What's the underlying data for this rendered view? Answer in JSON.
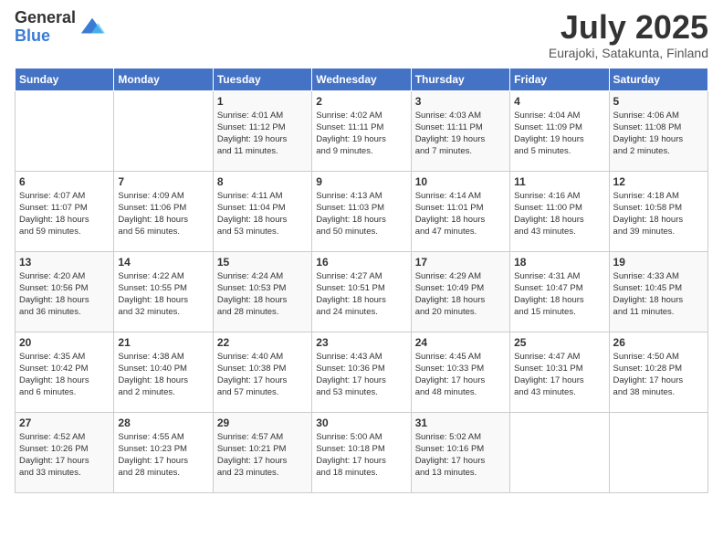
{
  "header": {
    "logo_general": "General",
    "logo_blue": "Blue",
    "month_title": "July 2025",
    "location": "Eurajoki, Satakunta, Finland"
  },
  "weekdays": [
    "Sunday",
    "Monday",
    "Tuesday",
    "Wednesday",
    "Thursday",
    "Friday",
    "Saturday"
  ],
  "weeks": [
    [
      {
        "day": "",
        "info": ""
      },
      {
        "day": "",
        "info": ""
      },
      {
        "day": "1",
        "info": "Sunrise: 4:01 AM\nSunset: 11:12 PM\nDaylight: 19 hours\nand 11 minutes."
      },
      {
        "day": "2",
        "info": "Sunrise: 4:02 AM\nSunset: 11:11 PM\nDaylight: 19 hours\nand 9 minutes."
      },
      {
        "day": "3",
        "info": "Sunrise: 4:03 AM\nSunset: 11:11 PM\nDaylight: 19 hours\nand 7 minutes."
      },
      {
        "day": "4",
        "info": "Sunrise: 4:04 AM\nSunset: 11:09 PM\nDaylight: 19 hours\nand 5 minutes."
      },
      {
        "day": "5",
        "info": "Sunrise: 4:06 AM\nSunset: 11:08 PM\nDaylight: 19 hours\nand 2 minutes."
      }
    ],
    [
      {
        "day": "6",
        "info": "Sunrise: 4:07 AM\nSunset: 11:07 PM\nDaylight: 18 hours\nand 59 minutes."
      },
      {
        "day": "7",
        "info": "Sunrise: 4:09 AM\nSunset: 11:06 PM\nDaylight: 18 hours\nand 56 minutes."
      },
      {
        "day": "8",
        "info": "Sunrise: 4:11 AM\nSunset: 11:04 PM\nDaylight: 18 hours\nand 53 minutes."
      },
      {
        "day": "9",
        "info": "Sunrise: 4:13 AM\nSunset: 11:03 PM\nDaylight: 18 hours\nand 50 minutes."
      },
      {
        "day": "10",
        "info": "Sunrise: 4:14 AM\nSunset: 11:01 PM\nDaylight: 18 hours\nand 47 minutes."
      },
      {
        "day": "11",
        "info": "Sunrise: 4:16 AM\nSunset: 11:00 PM\nDaylight: 18 hours\nand 43 minutes."
      },
      {
        "day": "12",
        "info": "Sunrise: 4:18 AM\nSunset: 10:58 PM\nDaylight: 18 hours\nand 39 minutes."
      }
    ],
    [
      {
        "day": "13",
        "info": "Sunrise: 4:20 AM\nSunset: 10:56 PM\nDaylight: 18 hours\nand 36 minutes."
      },
      {
        "day": "14",
        "info": "Sunrise: 4:22 AM\nSunset: 10:55 PM\nDaylight: 18 hours\nand 32 minutes."
      },
      {
        "day": "15",
        "info": "Sunrise: 4:24 AM\nSunset: 10:53 PM\nDaylight: 18 hours\nand 28 minutes."
      },
      {
        "day": "16",
        "info": "Sunrise: 4:27 AM\nSunset: 10:51 PM\nDaylight: 18 hours\nand 24 minutes."
      },
      {
        "day": "17",
        "info": "Sunrise: 4:29 AM\nSunset: 10:49 PM\nDaylight: 18 hours\nand 20 minutes."
      },
      {
        "day": "18",
        "info": "Sunrise: 4:31 AM\nSunset: 10:47 PM\nDaylight: 18 hours\nand 15 minutes."
      },
      {
        "day": "19",
        "info": "Sunrise: 4:33 AM\nSunset: 10:45 PM\nDaylight: 18 hours\nand 11 minutes."
      }
    ],
    [
      {
        "day": "20",
        "info": "Sunrise: 4:35 AM\nSunset: 10:42 PM\nDaylight: 18 hours\nand 6 minutes."
      },
      {
        "day": "21",
        "info": "Sunrise: 4:38 AM\nSunset: 10:40 PM\nDaylight: 18 hours\nand 2 minutes."
      },
      {
        "day": "22",
        "info": "Sunrise: 4:40 AM\nSunset: 10:38 PM\nDaylight: 17 hours\nand 57 minutes."
      },
      {
        "day": "23",
        "info": "Sunrise: 4:43 AM\nSunset: 10:36 PM\nDaylight: 17 hours\nand 53 minutes."
      },
      {
        "day": "24",
        "info": "Sunrise: 4:45 AM\nSunset: 10:33 PM\nDaylight: 17 hours\nand 48 minutes."
      },
      {
        "day": "25",
        "info": "Sunrise: 4:47 AM\nSunset: 10:31 PM\nDaylight: 17 hours\nand 43 minutes."
      },
      {
        "day": "26",
        "info": "Sunrise: 4:50 AM\nSunset: 10:28 PM\nDaylight: 17 hours\nand 38 minutes."
      }
    ],
    [
      {
        "day": "27",
        "info": "Sunrise: 4:52 AM\nSunset: 10:26 PM\nDaylight: 17 hours\nand 33 minutes."
      },
      {
        "day": "28",
        "info": "Sunrise: 4:55 AM\nSunset: 10:23 PM\nDaylight: 17 hours\nand 28 minutes."
      },
      {
        "day": "29",
        "info": "Sunrise: 4:57 AM\nSunset: 10:21 PM\nDaylight: 17 hours\nand 23 minutes."
      },
      {
        "day": "30",
        "info": "Sunrise: 5:00 AM\nSunset: 10:18 PM\nDaylight: 17 hours\nand 18 minutes."
      },
      {
        "day": "31",
        "info": "Sunrise: 5:02 AM\nSunset: 10:16 PM\nDaylight: 17 hours\nand 13 minutes."
      },
      {
        "day": "",
        "info": ""
      },
      {
        "day": "",
        "info": ""
      }
    ]
  ]
}
